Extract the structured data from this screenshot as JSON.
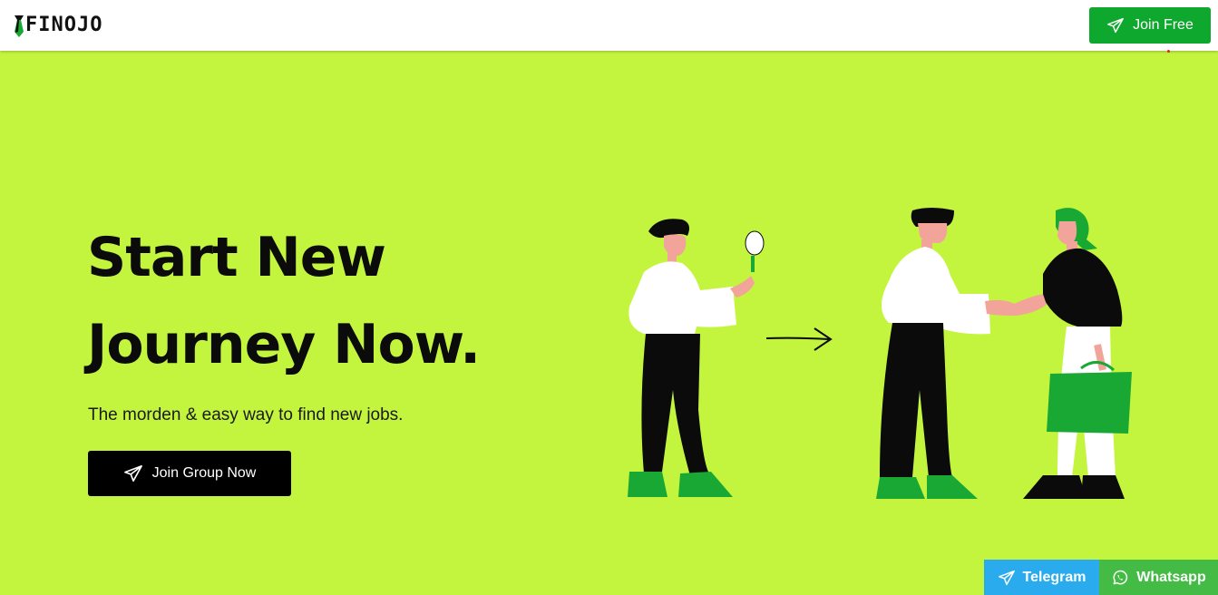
{
  "header": {
    "logo_text": "FINOJO",
    "join_free_label": "Join Free"
  },
  "hero": {
    "title_line1": "Start New",
    "title_line2": "Journey Now.",
    "subtitle": "The morden & easy way to find new jobs.",
    "cta_label": "Join Group Now"
  },
  "floating": {
    "telegram_label": "Telegram",
    "whatsapp_label": "Whatsapp"
  },
  "colors": {
    "background": "#c4f53e",
    "primary_green": "#0fa82f",
    "telegram_blue": "#2aabee",
    "whatsapp_green": "#43bb44",
    "cta_black": "#000000"
  },
  "icons": [
    "tie-logo-icon",
    "paper-plane-icon",
    "whatsapp-icon"
  ]
}
